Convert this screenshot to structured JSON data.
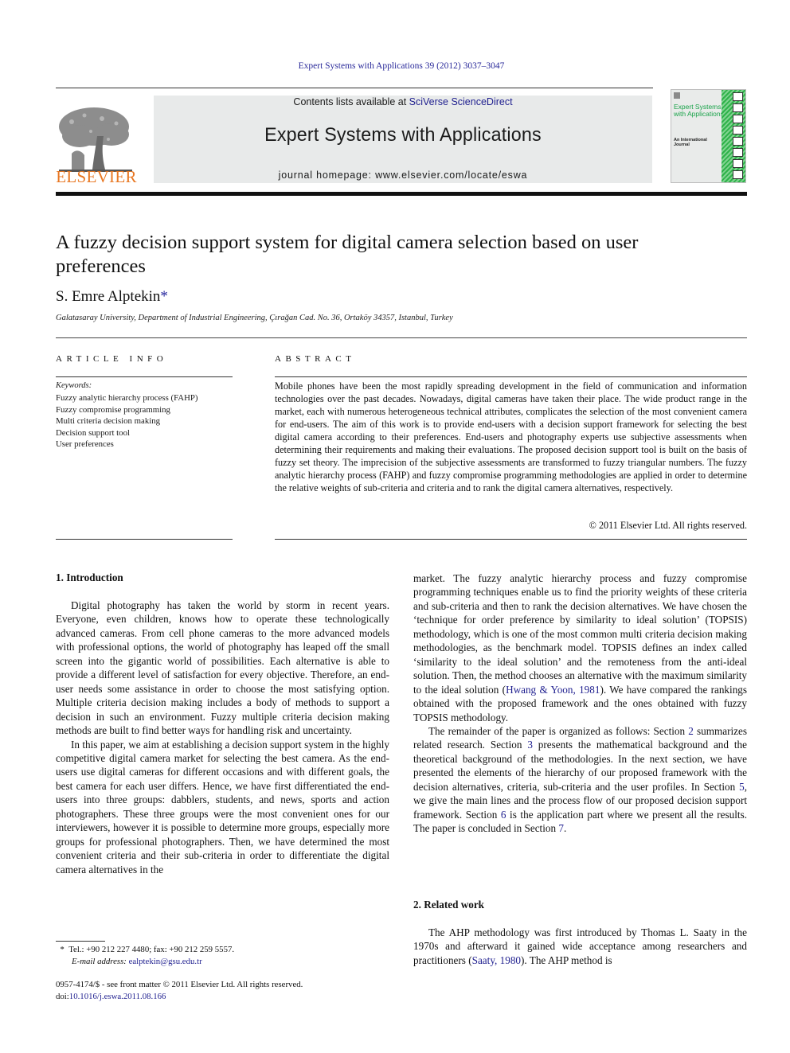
{
  "header": {
    "citation": "Expert Systems with Applications 39 (2012) 3037–3047",
    "contents_prefix": "Contents lists available at ",
    "contents_link": "SciVerse ScienceDirect",
    "journal_name": "Expert Systems with Applications",
    "homepage": "journal homepage: www.elsevier.com/locate/eswa",
    "publisher_logo_text": "ELSEVIER",
    "cover": {
      "title": "Expert Systems with Applications",
      "subtitle": "An International Journal",
      "accent_color": "#2fb24a"
    },
    "colors": {
      "link": "#1f1f8f",
      "elsevier_orange": "#e87722",
      "banner_bg": "#e8eaea"
    }
  },
  "article": {
    "title": "A fuzzy decision support system for digital camera selection based on user preferences",
    "author": "S. Emre Alptekin",
    "author_mark": "*",
    "affiliation": "Galatasaray University, Department of Industrial Engineering, Çırağan Cad. No. 36, Ortaköy 34357, Istanbul, Turkey"
  },
  "article_info": {
    "heading": "ARTICLE INFO",
    "keywords_label": "Keywords:",
    "keywords": [
      "Fuzzy analytic hierarchy process (FAHP)",
      "Fuzzy compromise programming",
      "Multi criteria decision making",
      "Decision support tool",
      "User preferences"
    ]
  },
  "abstract": {
    "heading": "ABSTRACT",
    "text": "Mobile phones have been the most rapidly spreading development in the field of communication and information technologies over the past decades. Nowadays, digital cameras have taken their place. The wide product range in the market, each with numerous heterogeneous technical attributes, complicates the selection of the most convenient camera for end-users. The aim of this work is to provide end-users with a decision support framework for selecting the best digital camera according to their preferences. End-users and photography experts use subjective assessments when determining their requirements and making their evaluations. The proposed decision support tool is built on the basis of fuzzy set theory. The imprecision of the subjective assessments are transformed to fuzzy triangular numbers. The fuzzy analytic hierarchy process (FAHP) and fuzzy compromise programming methodologies are applied in order to determine the relative weights of sub-criteria and criteria and to rank the digital camera alternatives, respectively.",
    "copyright": "© 2011 Elsevier Ltd. All rights reserved."
  },
  "body": {
    "section1_heading": "1. Introduction",
    "s1_p1": "Digital photography has taken the world by storm in recent years. Everyone, even children, knows how to operate these technologically advanced cameras. From cell phone cameras to the more advanced models with professional options, the world of photography has leaped off the small screen into the gigantic world of possibilities. Each alternative is able to provide a different level of satisfaction for every objective. Therefore, an end-user needs some assistance in order to choose the most satisfying option. Multiple criteria decision making includes a body of methods to support a decision in such an environment. Fuzzy multiple criteria decision making methods are built to find better ways for handling risk and uncertainty.",
    "s1_p2": "In this paper, we aim at establishing a decision support system in the highly competitive digital camera market for selecting the best camera. As the end-users use digital cameras for different occasions and with different goals, the best camera for each user differs. Hence, we have first differentiated the end-users into three groups: dabblers, students, and news, sports and action photographers. These three groups were the most convenient ones for our interviewers, however it is possible to determine more groups, especially more groups for professional photographers. Then, we have determined the most convenient criteria and their sub-criteria in order to differentiate the digital camera alternatives in the",
    "s1_p2_cont_a": "market. The fuzzy analytic hierarchy process and fuzzy compromise programming techniques enable us to find the priority weights of these criteria and sub-criteria and then to rank the decision alternatives. We have chosen the ‘technique for order preference by similarity to ideal solution’ (TOPSIS) methodology, which is one of the most common multi criteria decision making methodologies, as the benchmark model. TOPSIS defines an index called ‘similarity to the ideal solution’ and the remoteness from the anti-ideal solution. Then, the method chooses an alternative with the maximum similarity to the ideal solution (",
    "s1_p2_cite": "Hwang & Yoon, 1981",
    "s1_p2_cont_b": "). We have compared the rankings obtained with the proposed framework and the ones obtained with fuzzy TOPSIS methodology.",
    "s1_p3_a": "The remainder of the paper is organized as follows: Section ",
    "s1_p3_ref2": "2",
    "s1_p3_b": " summarizes related research. Section ",
    "s1_p3_ref3": "3",
    "s1_p3_c": " presents the mathematical background and the theoretical background of the methodologies. In the next section, we have presented the elements of the hierarchy of our proposed framework with the decision alternatives, criteria, sub-criteria and the user profiles. In Section ",
    "s1_p3_ref5": "5",
    "s1_p3_d": ", we give the main lines and the process flow of our proposed decision support framework. Section ",
    "s1_p3_ref6": "6",
    "s1_p3_e": " is the application part where we present all the results. The paper is concluded in Section ",
    "s1_p3_ref7": "7",
    "s1_p3_f": ".",
    "section2_heading": "2. Related work",
    "s2_p1_a": "The AHP methodology was first introduced by Thomas L. Saaty in the 1970s and afterward it gained wide acceptance among researchers and practitioners (",
    "s2_p1_cite": "Saaty, 1980",
    "s2_p1_b": "). The AHP method is"
  },
  "footnotes": {
    "mark": "*",
    "contact": "Tel.: +90 212 227 4480; fax: +90 212 259 5557.",
    "email_label": "E-mail address:",
    "email": "ealptekin@gsu.edu.tr",
    "issn_line": "0957-4174/$ - see front matter © 2011 Elsevier Ltd. All rights reserved.",
    "doi_label": "doi:",
    "doi": "10.1016/j.eswa.2011.08.166"
  }
}
